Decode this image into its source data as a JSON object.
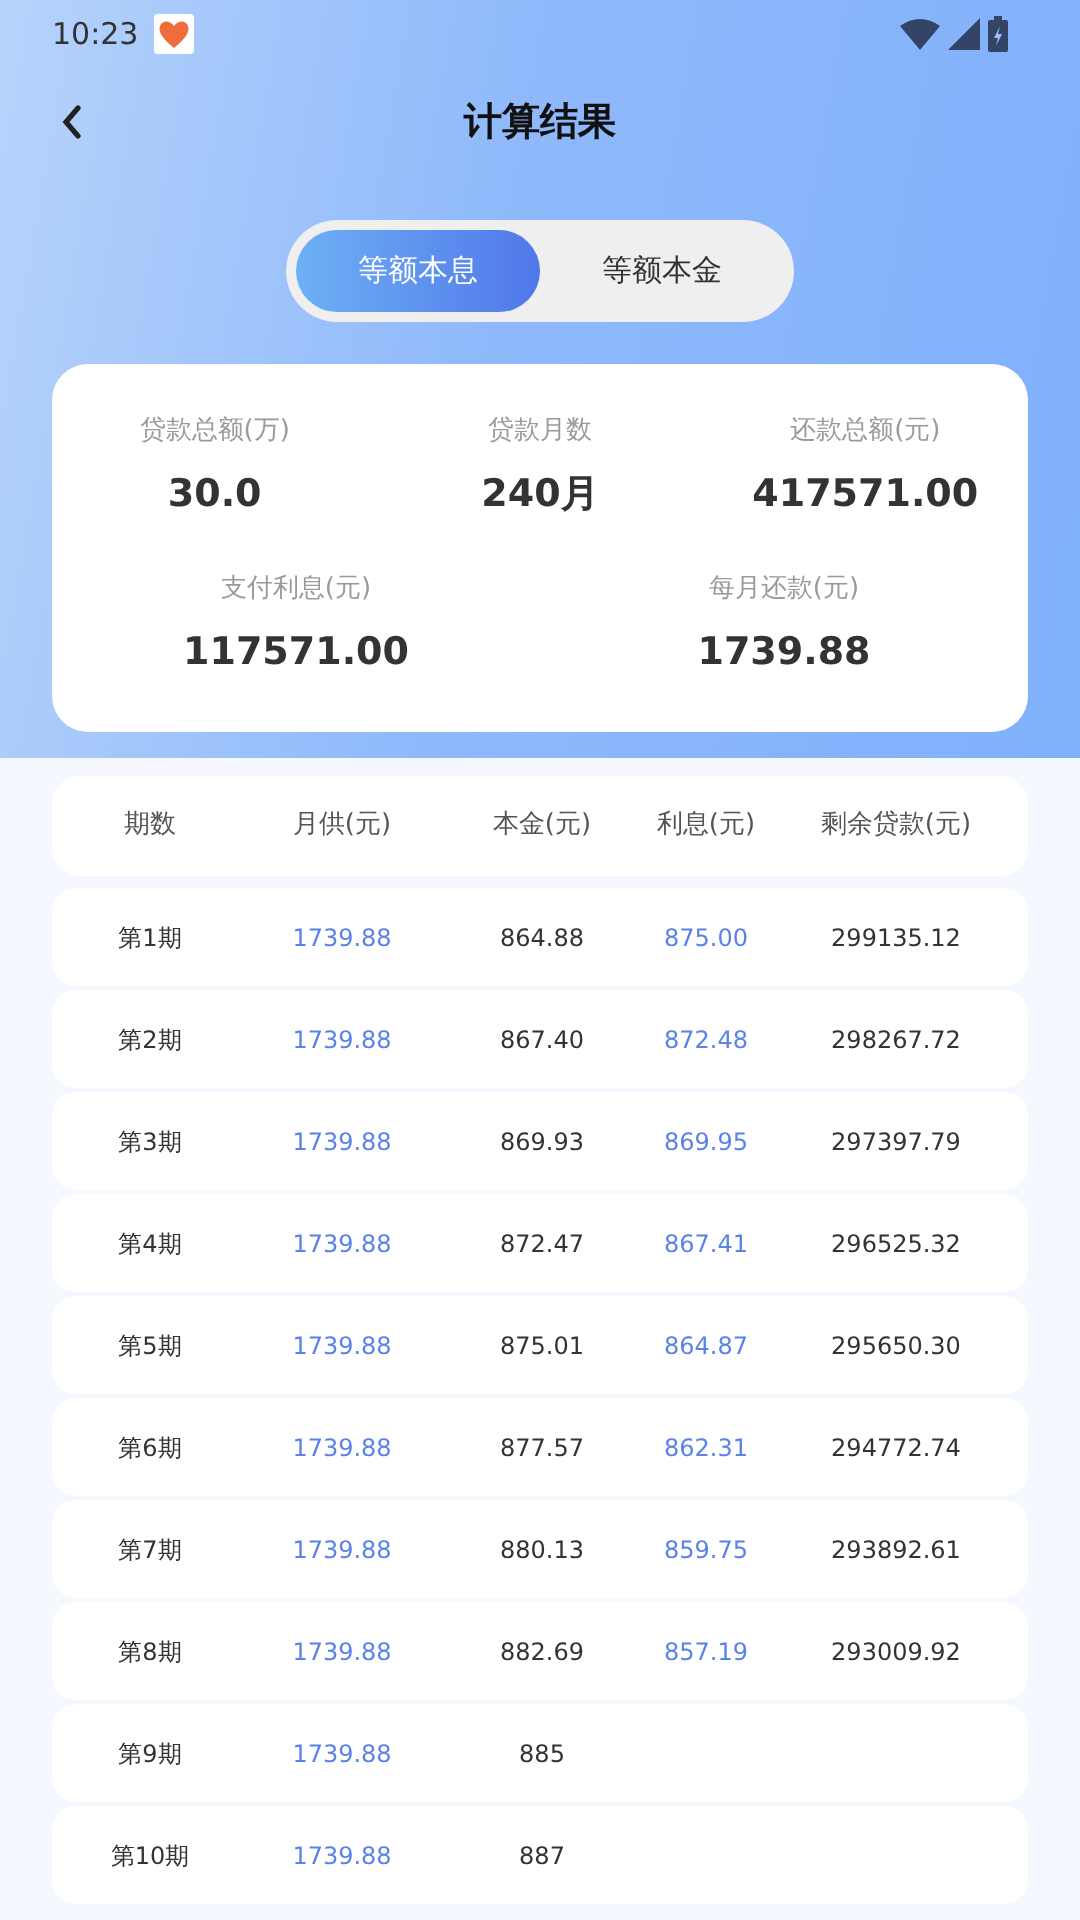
{
  "status_bar": {
    "time": "10:23"
  },
  "header": {
    "title": "计算结果"
  },
  "tabs": [
    {
      "label": "等额本息",
      "selected": true
    },
    {
      "label": "等额本金",
      "selected": false
    }
  ],
  "summary": [
    {
      "label": "贷款总额(万)",
      "value": "30.0"
    },
    {
      "label": "贷款月数",
      "value": "240月"
    },
    {
      "label": "还款总额(元)",
      "value": "417571.00"
    },
    {
      "label": "支付利息(元)",
      "value": "117571.00"
    },
    {
      "label": "每月还款(元)",
      "value": "1739.88"
    }
  ],
  "table": {
    "columns": [
      {
        "label": "期数",
        "highlight": false
      },
      {
        "label": "月供(元)",
        "highlight": true
      },
      {
        "label": "本金(元)",
        "highlight": false
      },
      {
        "label": "利息(元)",
        "highlight": true
      },
      {
        "label": "剩余贷款(元)",
        "highlight": false
      }
    ],
    "rows": [
      [
        "第1期",
        "1739.88",
        "864.88",
        "875.00",
        "299135.12"
      ],
      [
        "第2期",
        "1739.88",
        "867.40",
        "872.48",
        "298267.72"
      ],
      [
        "第3期",
        "1739.88",
        "869.93",
        "869.95",
        "297397.79"
      ],
      [
        "第4期",
        "1739.88",
        "872.47",
        "867.41",
        "296525.32"
      ],
      [
        "第5期",
        "1739.88",
        "875.01",
        "864.87",
        "295650.30"
      ],
      [
        "第6期",
        "1739.88",
        "877.57",
        "862.31",
        "294772.74"
      ],
      [
        "第7期",
        "1739.88",
        "880.13",
        "859.75",
        "293892.61"
      ],
      [
        "第8期",
        "1739.88",
        "882.69",
        "857.19",
        "293009.92"
      ],
      [
        "第9期",
        "1739.88",
        "885"
      ],
      [
        "第10期",
        "1739.88",
        "887"
      ]
    ]
  }
}
